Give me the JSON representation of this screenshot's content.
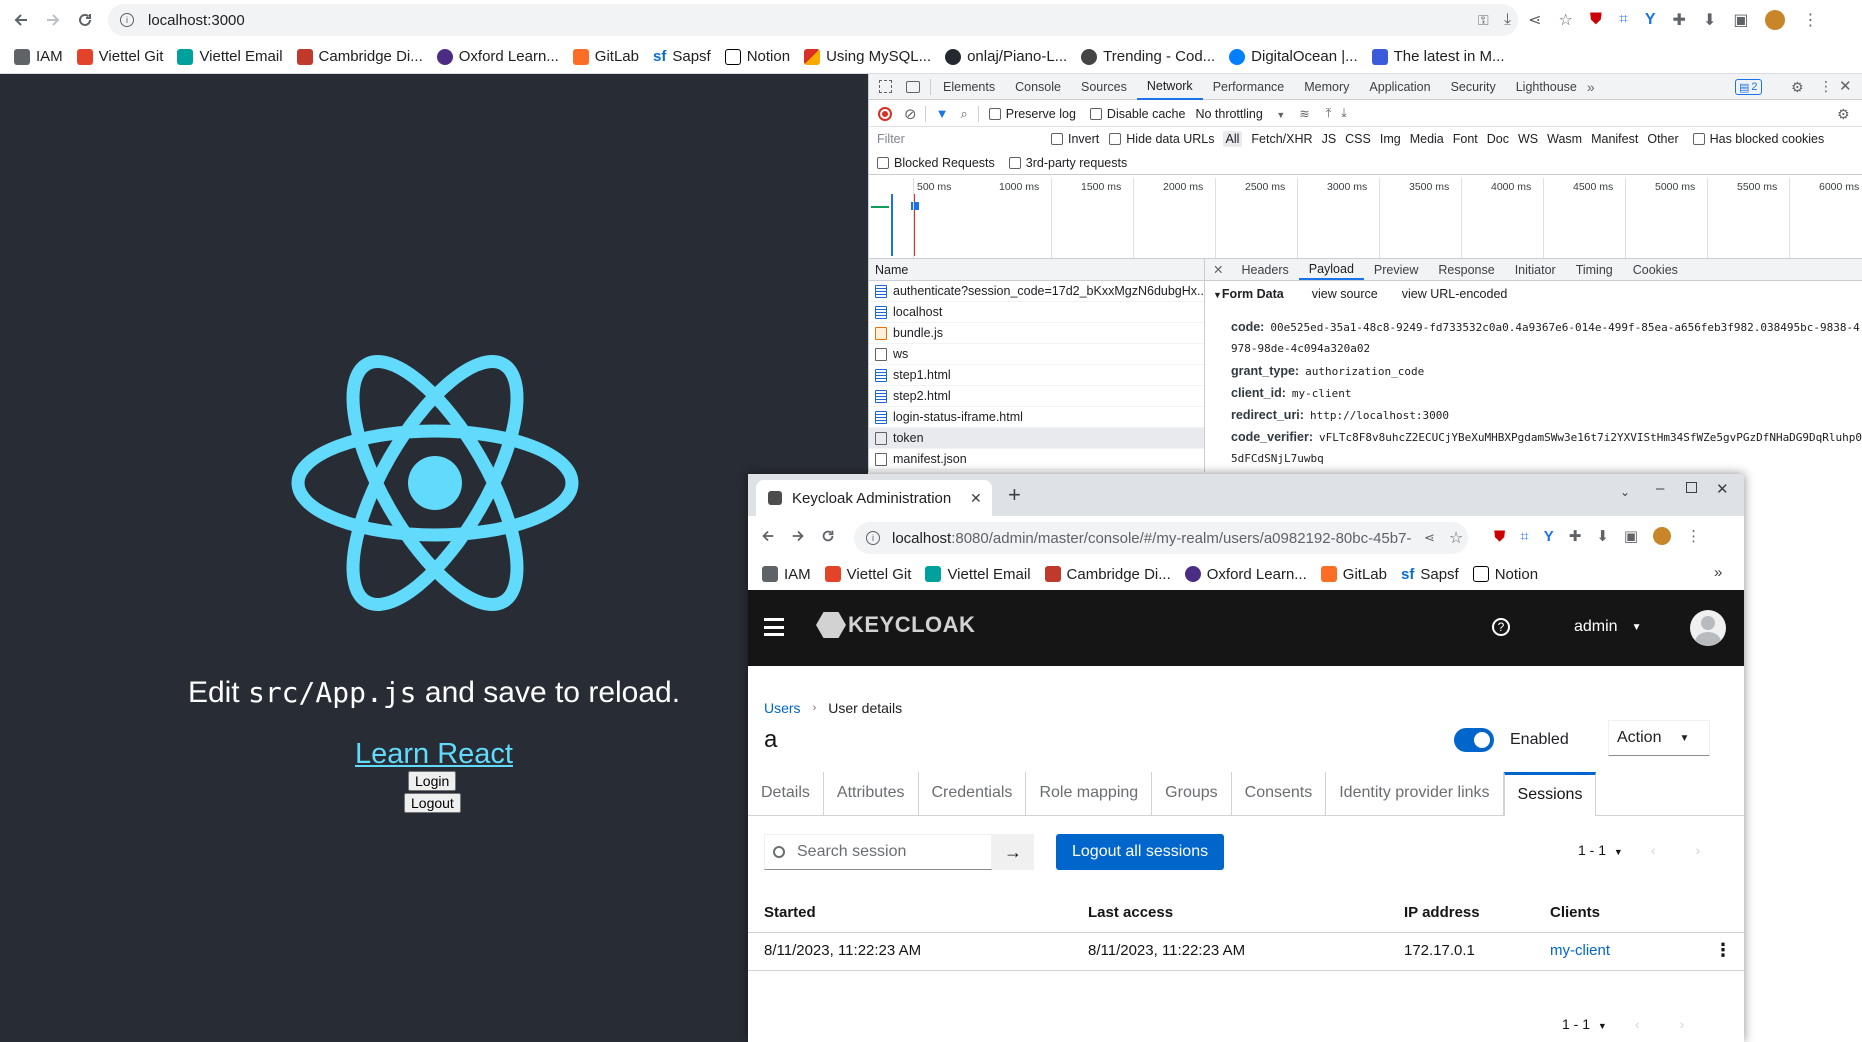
{
  "browser": {
    "url": "localhost:3000",
    "bookmarks": [
      "IAM",
      "Viettel Git",
      "Viettel Email",
      "Cambridge Di...",
      "Oxford Learn...",
      "GitLab",
      "Sapsf",
      "Notion",
      "Using MySQL...",
      "onlaj/Piano-L...",
      "Trending - Cod...",
      "DigitalOcean |...",
      "The latest in M..."
    ],
    "extension_badge": "2"
  },
  "react_app": {
    "edit_prefix": "Edit ",
    "edit_code": "src/App.js",
    "edit_suffix": " and save to reload.",
    "learn_link": "Learn React",
    "login_button": "Login",
    "logout_button": "Logout"
  },
  "devtools": {
    "tabs": [
      "Elements",
      "Console",
      "Sources",
      "Network",
      "Performance",
      "Memory",
      "Application",
      "Security",
      "Lighthouse"
    ],
    "active_tab": "Network",
    "issues_count": "2",
    "preserve_log": "Preserve log",
    "disable_cache": "Disable cache",
    "throttling": "No throttling",
    "filter_placeholder": "Filter",
    "invert": "Invert",
    "hide_data_urls": "Hide data URLs",
    "type_filters": [
      "All",
      "Fetch/XHR",
      "JS",
      "CSS",
      "Img",
      "Media",
      "Font",
      "Doc",
      "WS",
      "Wasm",
      "Manifest",
      "Other"
    ],
    "has_blocked_cookies": "Has blocked cookies",
    "blocked_requests": "Blocked Requests",
    "third_party": "3rd-party requests",
    "timeline_ticks": [
      "500 ms",
      "1000 ms",
      "1500 ms",
      "2000 ms",
      "2500 ms",
      "3000 ms",
      "3500 ms",
      "4000 ms",
      "4500 ms",
      "5000 ms",
      "5500 ms",
      "6000 ms"
    ],
    "name_header": "Name",
    "requests": [
      {
        "name": "authenticate?session_code=17d2_bKxxMgzN6dubgHx...",
        "type": "doc"
      },
      {
        "name": "localhost",
        "type": "doc"
      },
      {
        "name": "bundle.js",
        "type": "js"
      },
      {
        "name": "ws",
        "type": "other"
      },
      {
        "name": "step1.html",
        "type": "doc"
      },
      {
        "name": "step2.html",
        "type": "doc"
      },
      {
        "name": "login-status-iframe.html",
        "type": "doc"
      },
      {
        "name": "token",
        "type": "other"
      },
      {
        "name": "manifest.json",
        "type": "other"
      }
    ],
    "detail_tabs": [
      "Headers",
      "Payload",
      "Preview",
      "Response",
      "Initiator",
      "Timing",
      "Cookies"
    ],
    "active_detail_tab": "Payload",
    "form_data_label": "Form Data",
    "view_source": "view source",
    "view_url_encoded": "view URL-encoded",
    "form": {
      "code_key": "code:",
      "code_val1": "00e525ed-35a1-48c8-9249-fd733532c0a0.4a9367e6-014e-499f-85ea-a656feb3f982.038495bc-9838-4",
      "code_val2": "978-98de-4c094a320a02",
      "grant_key": "grant_type:",
      "grant_val": "authorization_code",
      "client_key": "client_id:",
      "client_val": "my-client",
      "redirect_key": "redirect_uri:",
      "redirect_val": "http://localhost:3000",
      "verifier_key": "code_verifier:",
      "verifier_val1": "vFLTc8F8v8uhcZ2ECUCjYBeXuMHBXPgdamSWw3e16t7i2YXVIStHm34SfWZe5gvPGzDfNHaDG9DqRluhp0",
      "verifier_val2": "5dFCdSNjL7uwbq"
    }
  },
  "keycloak_window": {
    "tab_title": "Keycloak Administration",
    "url_host": "localhost",
    "url_rest": ":8080/admin/master/console/#/my-realm/users/a0982192-80bc-45b7-...",
    "bookmarks": [
      "IAM",
      "Viettel Git",
      "Viettel Email",
      "Cambridge Di...",
      "Oxford Learn...",
      "GitLab",
      "Sapsf",
      "Notion"
    ],
    "logo_text": "KEYCLOAK",
    "user_menu": "admin",
    "breadcrumb_users": "Users",
    "breadcrumb_current": "User details",
    "username": "a",
    "enabled_label": "Enabled",
    "action_label": "Action",
    "tabs": [
      "Details",
      "Attributes",
      "Credentials",
      "Role mapping",
      "Groups",
      "Consents",
      "Identity provider links",
      "Sessions"
    ],
    "active_tab": "Sessions",
    "search_placeholder": "Search session",
    "logout_all": "Logout all sessions",
    "pagination": "1 - 1",
    "columns": [
      "Started",
      "Last access",
      "IP address",
      "Clients"
    ],
    "sessions": [
      {
        "started": "8/11/2023, 11:22:23 AM",
        "last_access": "8/11/2023, 11:22:23 AM",
        "ip": "172.17.0.1",
        "client": "my-client"
      }
    ]
  },
  "colors": {
    "react_bg": "#282c34",
    "react_blue": "#61dafb",
    "keycloak_header": "#151515",
    "pf_blue": "#0066cc"
  }
}
